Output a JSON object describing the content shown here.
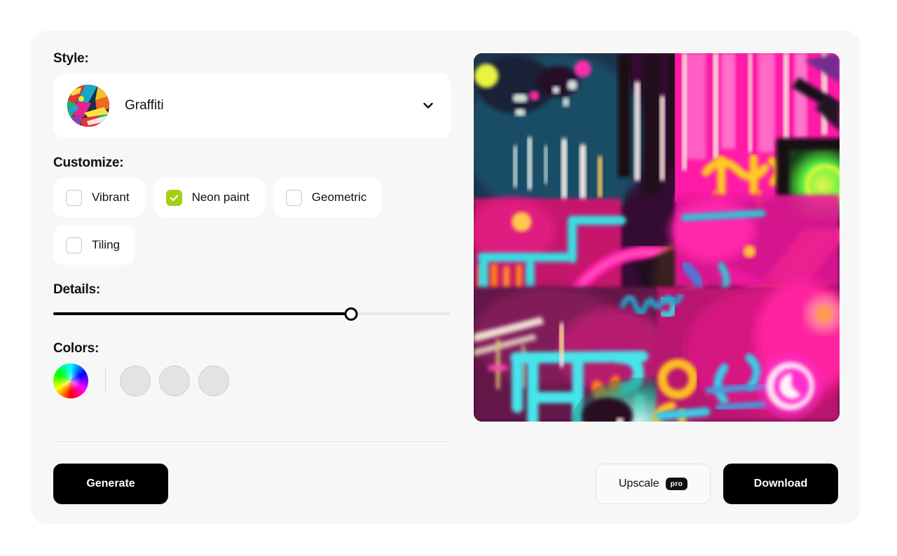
{
  "theme": {
    "page_bg": "#ffffff",
    "panel_bg": "#f7f7f7",
    "card_bg": "#ffffff",
    "accent_checked": "#a6ce16",
    "button_primary_bg": "#000000",
    "button_primary_text": "#ffffff",
    "divider": "#e4e4e4"
  },
  "style_section": {
    "label": "Style:",
    "selected": "Graffiti",
    "thumbnail_name": "graffiti-style-thumbnail",
    "chevron_icon": "chevron-down-icon"
  },
  "customize_section": {
    "label": "Customize:",
    "options": [
      {
        "label": "Vibrant",
        "checked": false
      },
      {
        "label": "Neon paint",
        "checked": true
      },
      {
        "label": "Geometric",
        "checked": false
      },
      {
        "label": "Tiling",
        "checked": false
      }
    ]
  },
  "details_section": {
    "label": "Details:",
    "value_percent": 75,
    "min": 0,
    "max": 100
  },
  "colors_section": {
    "label": "Colors:",
    "wheel_icon": "color-wheel-icon",
    "swatches": [
      {
        "name": "color-swatch-1",
        "color": "#e3e3e3",
        "empty": true
      },
      {
        "name": "color-swatch-2",
        "color": "#e3e3e3",
        "empty": true
      },
      {
        "name": "color-swatch-3",
        "color": "#e3e3e3",
        "empty": true
      }
    ]
  },
  "actions": {
    "generate_label": "Generate",
    "upscale_label": "Upscale",
    "upscale_badge": "pro",
    "download_label": "Download"
  },
  "preview": {
    "name": "generated-image-preview",
    "alt": "Generated graffiti artwork with neon pink, cyan, orange and yellow spray paint"
  }
}
